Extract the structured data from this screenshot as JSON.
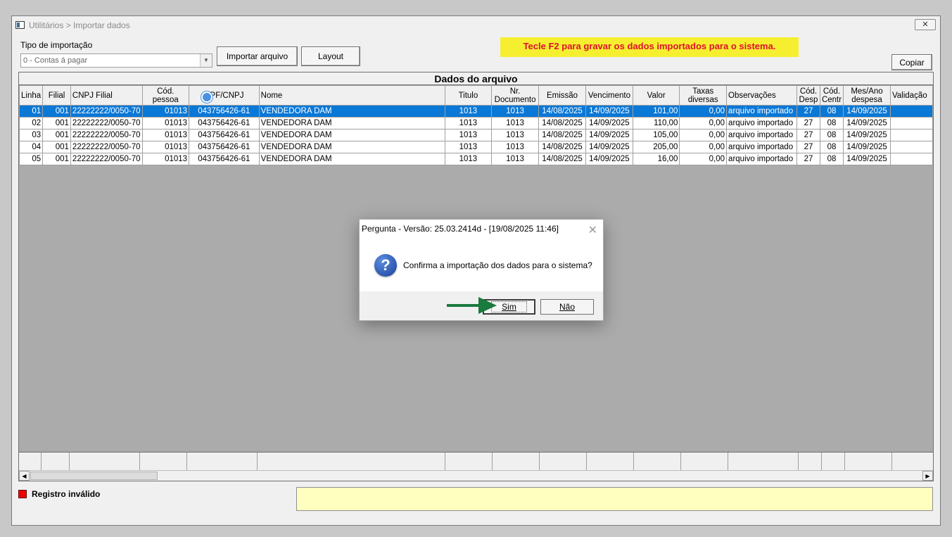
{
  "window": {
    "title": "Utilitários > Importar dados",
    "close_label": "✕"
  },
  "form": {
    "tipo_label": "Tipo de importação",
    "tipo_value": "0 - Contas á pagar",
    "import_button": "Importar arquivo",
    "layout_button": "Layout",
    "copy_button": "Copiar",
    "f2_notice": "Tecle F2 para gravar os dados importados para o sistema."
  },
  "grid": {
    "caption": "Dados do arquivo",
    "headers": [
      "Linha",
      "Filial",
      "CNPJ Filial",
      "Cód. pessoa",
      "CPF/CNPJ",
      "Nome",
      "Titulo",
      "Nr. Documento",
      "Emissão",
      "Vencimento",
      "Valor",
      "Taxas diversas",
      "Observações",
      "Cód. Desp",
      "Cód. Centr",
      "Mes/Ano despesa",
      "Validação"
    ],
    "rows": [
      [
        "01",
        "001",
        "22222222/0050-70",
        "01013",
        "043756426-61",
        "VENDEDORA DAM",
        "1013",
        "1013",
        "14/08/2025",
        "14/09/2025",
        "101,00",
        "0,00",
        "arquivo importado",
        "27",
        "08",
        "14/09/2025",
        ""
      ],
      [
        "02",
        "001",
        "22222222/0050-70",
        "01013",
        "043756426-61",
        "VENDEDORA DAM",
        "1013",
        "1013",
        "14/08/2025",
        "14/09/2025",
        "110,00",
        "0,00",
        "arquivo importado",
        "27",
        "08",
        "14/09/2025",
        ""
      ],
      [
        "03",
        "001",
        "22222222/0050-70",
        "01013",
        "043756426-61",
        "VENDEDORA DAM",
        "1013",
        "1013",
        "14/08/2025",
        "14/09/2025",
        "105,00",
        "0,00",
        "arquivo importado",
        "27",
        "08",
        "14/09/2025",
        ""
      ],
      [
        "04",
        "001",
        "22222222/0050-70",
        "01013",
        "043756426-61",
        "VENDEDORA DAM",
        "1013",
        "1013",
        "14/08/2025",
        "14/09/2025",
        "205,00",
        "0,00",
        "arquivo importado",
        "27",
        "08",
        "14/09/2025",
        ""
      ],
      [
        "05",
        "001",
        "22222222/0050-70",
        "01013",
        "043756426-61",
        "VENDEDORA DAM",
        "1013",
        "1013",
        "14/08/2025",
        "14/09/2025",
        "16,00",
        "0,00",
        "arquivo importado",
        "27",
        "08",
        "14/09/2025",
        ""
      ]
    ],
    "selected_row": 0
  },
  "legend": {
    "invalid_label": "Registro inválido",
    "invalid_color": "#ee0000"
  },
  "dialog": {
    "title": "Pergunta - Versão: 25.03.2414d - [19/08/2025 11:46]",
    "message": "Confirma a importação dos dados para o sistema?",
    "yes_button": "Sim",
    "no_button": "Não"
  },
  "colors": {
    "selection": "#0a78d7",
    "notice_bg": "#f5ef30",
    "notice_text": "#e0102a",
    "message_area": "#ffffc0",
    "arrow": "#1b7a3e"
  }
}
